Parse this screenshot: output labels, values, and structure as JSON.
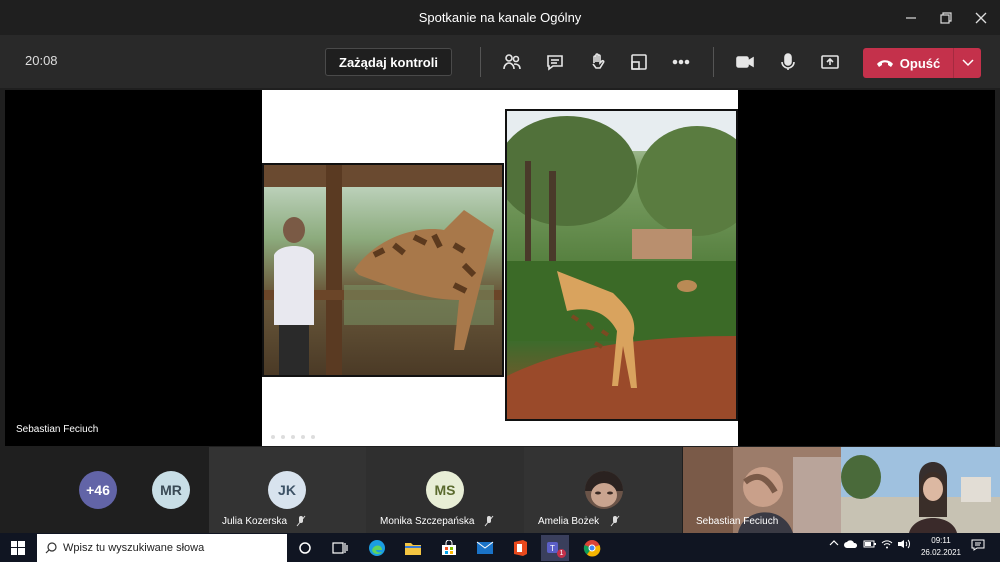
{
  "window": {
    "title": "Spotkanie na kanale Ogólny"
  },
  "toolbar": {
    "timer": "20:08",
    "request_control_label": "Zażądaj kontroli",
    "leave_label": "Opuść"
  },
  "stage": {
    "presenter_name": "Sebastian Feciuch"
  },
  "participants": {
    "overflow_count": "+46",
    "mr_initials": "MR",
    "jk_initials": "JK",
    "jk_name": "Julia Kozerska",
    "ms_initials": "MS",
    "ms_name": "Monika Szczepańska",
    "ab_name": "Amelia Bożek",
    "sf_name": "Sebastian Feciuch"
  },
  "taskbar": {
    "search_placeholder": "Wpisz tu wyszukiwane słowa",
    "time": "09:11",
    "date": "26.02.2021",
    "teams_badge": "1"
  },
  "colors": {
    "leave": "#c4314b",
    "overflow_avatar": "#6264a7",
    "teams_purple": "#5b5fc7"
  }
}
